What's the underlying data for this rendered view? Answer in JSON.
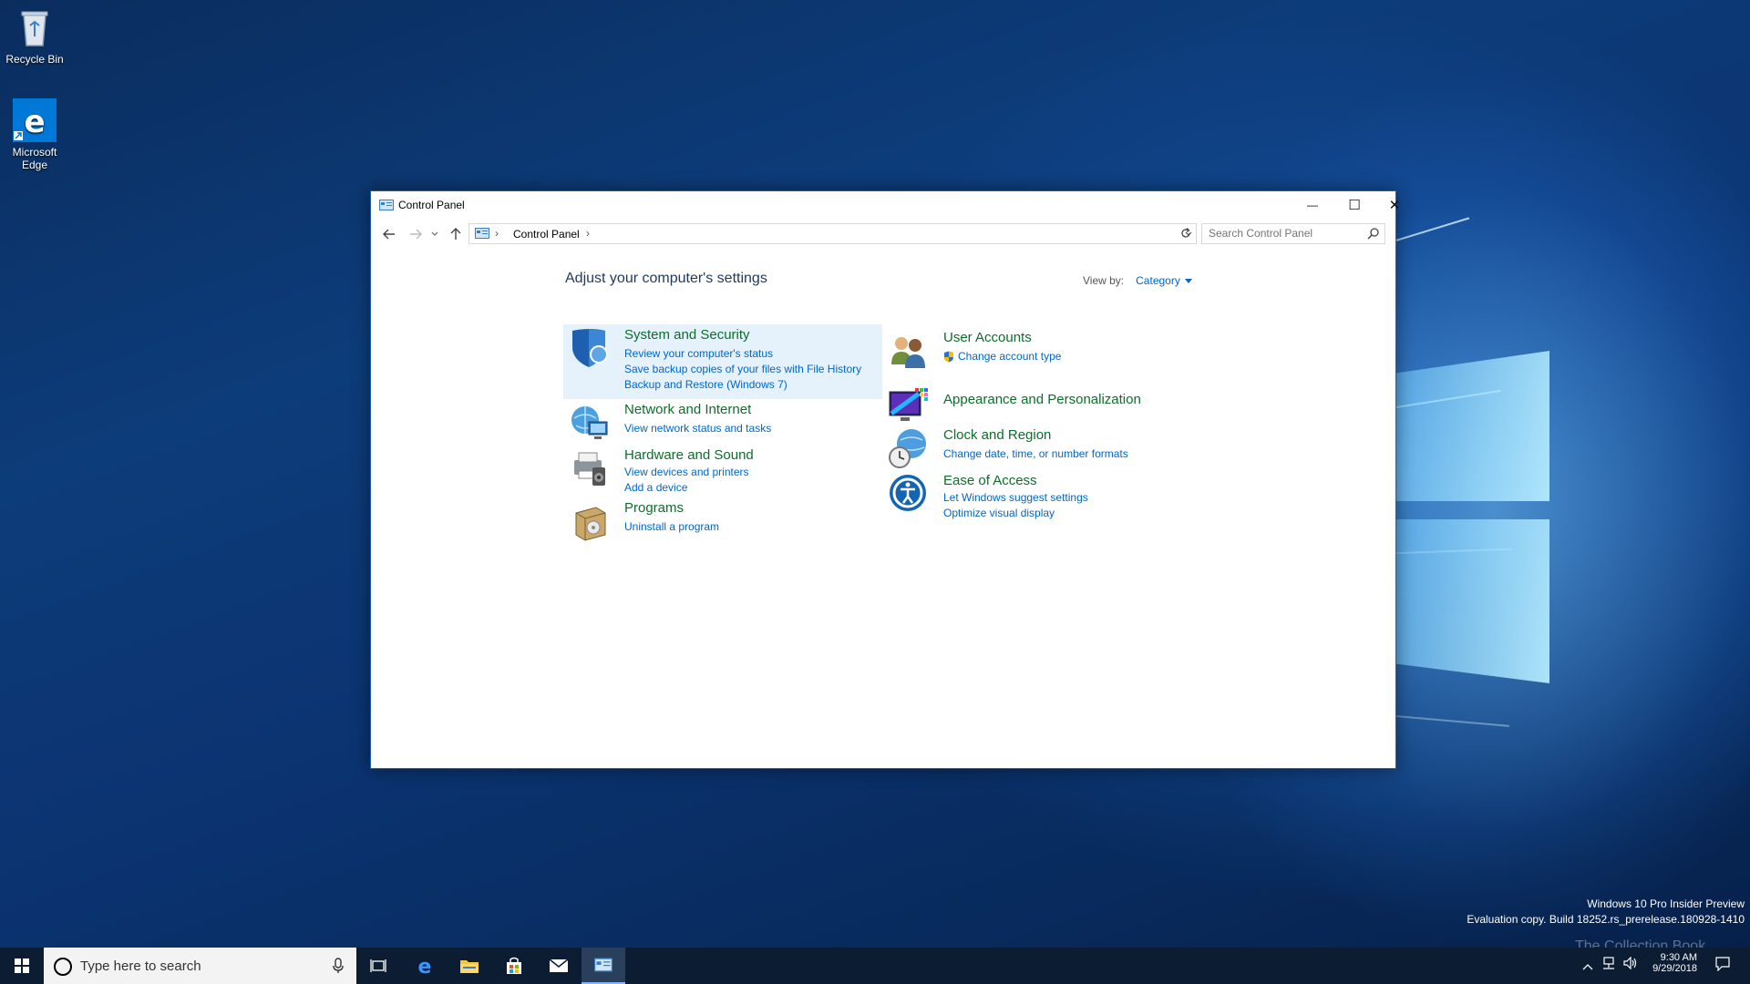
{
  "desktop": {
    "icons": [
      {
        "label": "Recycle Bin"
      },
      {
        "label": "Microsoft Edge"
      }
    ],
    "watermark": {
      "line1": "Windows 10 Pro Insider Preview",
      "line2": "Evaluation copy. Build 18252.rs_prerelease.180928-1410"
    },
    "overlay_text": "The Collection Book"
  },
  "window": {
    "title": "Control Panel",
    "controls": {
      "minimize": "—",
      "maximize": "☐",
      "close": "✕"
    },
    "address": {
      "breadcrumb": "Control Panel",
      "separator": "›"
    },
    "search": {
      "placeholder": "Search Control Panel"
    },
    "heading": "Adjust your computer's settings",
    "view_by": {
      "label": "View by:",
      "value": "Category"
    },
    "categories_left": [
      {
        "title": "System and Security",
        "icon": "shield-icon",
        "links": [
          "Review your computer's status",
          "Save backup copies of your files with File History",
          "Backup and Restore (Windows 7)"
        ]
      },
      {
        "title": "Network and Internet",
        "icon": "network-globe-icon",
        "links": [
          "View network status and tasks"
        ]
      },
      {
        "title": "Hardware and Sound",
        "icon": "printer-speaker-icon",
        "links": [
          "View devices and printers",
          "Add a device"
        ]
      },
      {
        "title": "Programs",
        "icon": "programs-box-icon",
        "links": [
          "Uninstall a program"
        ]
      }
    ],
    "categories_right": [
      {
        "title": "User Accounts",
        "icon": "users-icon",
        "links": [
          "Change account type"
        ]
      },
      {
        "title": "Appearance and Personalization",
        "icon": "monitor-palette-icon",
        "links": []
      },
      {
        "title": "Clock and Region",
        "icon": "clock-globe-icon",
        "links": [
          "Change date, time, or number formats"
        ]
      },
      {
        "title": "Ease of Access",
        "icon": "ease-of-access-icon",
        "links": [
          "Let Windows suggest settings",
          "Optimize visual display"
        ]
      }
    ]
  },
  "taskbar": {
    "search_placeholder": "Type here to search",
    "apps": [
      "task-view-icon",
      "edge-icon",
      "file-explorer-icon",
      "store-icon",
      "mail-icon",
      "control-panel-icon"
    ],
    "clock": {
      "time": "9:30 AM",
      "date": "9/29/2018"
    }
  },
  "colors": {
    "category_title": "#0d6e2a",
    "link": "#0066cc",
    "heading": "#1e395b",
    "highlight": "#e5f1fb",
    "taskbar": "#0b1c33"
  }
}
